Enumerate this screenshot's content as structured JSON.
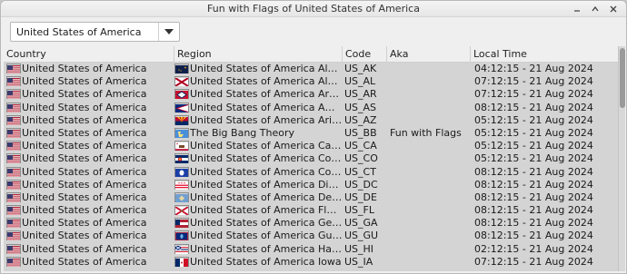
{
  "window": {
    "title": "Fun with Flags of United States of America",
    "controls": [
      "minimize-icon",
      "maximize-icon",
      "close-icon"
    ]
  },
  "country_select": {
    "value": "United States of America"
  },
  "table": {
    "columns": [
      "Country",
      "Region",
      "Code",
      "Aka",
      "Local Time"
    ],
    "rows": [
      {
        "country": "United States of America",
        "region": "United States of America Alaska",
        "code": "US_AK",
        "aka": "",
        "time": "04:12:15 - 21 Aug 2024",
        "region_flag": "alaska"
      },
      {
        "country": "United States of America",
        "region": "United States of America Alabama",
        "code": "US_AL",
        "aka": "",
        "time": "07:12:15 - 21 Aug 2024",
        "region_flag": "alabama"
      },
      {
        "country": "United States of America",
        "region": "United States of America Arkansas",
        "code": "US_AR",
        "aka": "",
        "time": "07:12:15 - 21 Aug 2024",
        "region_flag": "arkansas"
      },
      {
        "country": "United States of America",
        "region": "United States of America American Sa...",
        "code": "US_AS",
        "aka": "",
        "time": "08:12:15 - 21 Aug 2024",
        "region_flag": "american-samoa"
      },
      {
        "country": "United States of America",
        "region": "United States of America Arizona",
        "code": "US_AZ",
        "aka": "",
        "time": "05:12:15 - 21 Aug 2024",
        "region_flag": "arizona"
      },
      {
        "country": "United States of America",
        "region": "The Big Bang Theory",
        "code": "US_BB",
        "aka": "Fun with Flags",
        "time": "05:12:15 - 21 Aug 2024",
        "region_flag": "bbt"
      },
      {
        "country": "United States of America",
        "region": "United States of America California",
        "code": "US_CA",
        "aka": "",
        "time": "05:12:15 - 21 Aug 2024",
        "region_flag": "california"
      },
      {
        "country": "United States of America",
        "region": "United States of America Colorado",
        "code": "US_CO",
        "aka": "",
        "time": "05:12:15 - 21 Aug 2024",
        "region_flag": "colorado"
      },
      {
        "country": "United States of America",
        "region": "United States of America Connecticut",
        "code": "US_CT",
        "aka": "",
        "time": "08:12:15 - 21 Aug 2024",
        "region_flag": "connecticut"
      },
      {
        "country": "United States of America",
        "region": "United States of America District of Co...",
        "code": "US_DC",
        "aka": "",
        "time": "08:12:15 - 21 Aug 2024",
        "region_flag": "dc"
      },
      {
        "country": "United States of America",
        "region": "United States of America Delaware",
        "code": "US_DE",
        "aka": "",
        "time": "08:12:15 - 21 Aug 2024",
        "region_flag": "delaware"
      },
      {
        "country": "United States of America",
        "region": "United States of America Florida",
        "code": "US_FL",
        "aka": "",
        "time": "08:12:15 - 21 Aug 2024",
        "region_flag": "florida"
      },
      {
        "country": "United States of America",
        "region": "United States of America Georgia",
        "code": "US_GA",
        "aka": "",
        "time": "08:12:15 - 21 Aug 2024",
        "region_flag": "georgia"
      },
      {
        "country": "United States of America",
        "region": "United States of America Guam",
        "code": "US_GU",
        "aka": "",
        "time": "08:12:15 - 21 Aug 2024",
        "region_flag": "guam"
      },
      {
        "country": "United States of America",
        "region": "United States of America Hawaii",
        "code": "US_HI",
        "aka": "",
        "time": "02:12:15 - 21 Aug 2024",
        "region_flag": "hawaii"
      },
      {
        "country": "United States of America",
        "region": "United States of America Iowa",
        "code": "US_IA",
        "aka": "",
        "time": "07:12:15 - 21 Aug 2024",
        "region_flag": "iowa"
      }
    ]
  }
}
